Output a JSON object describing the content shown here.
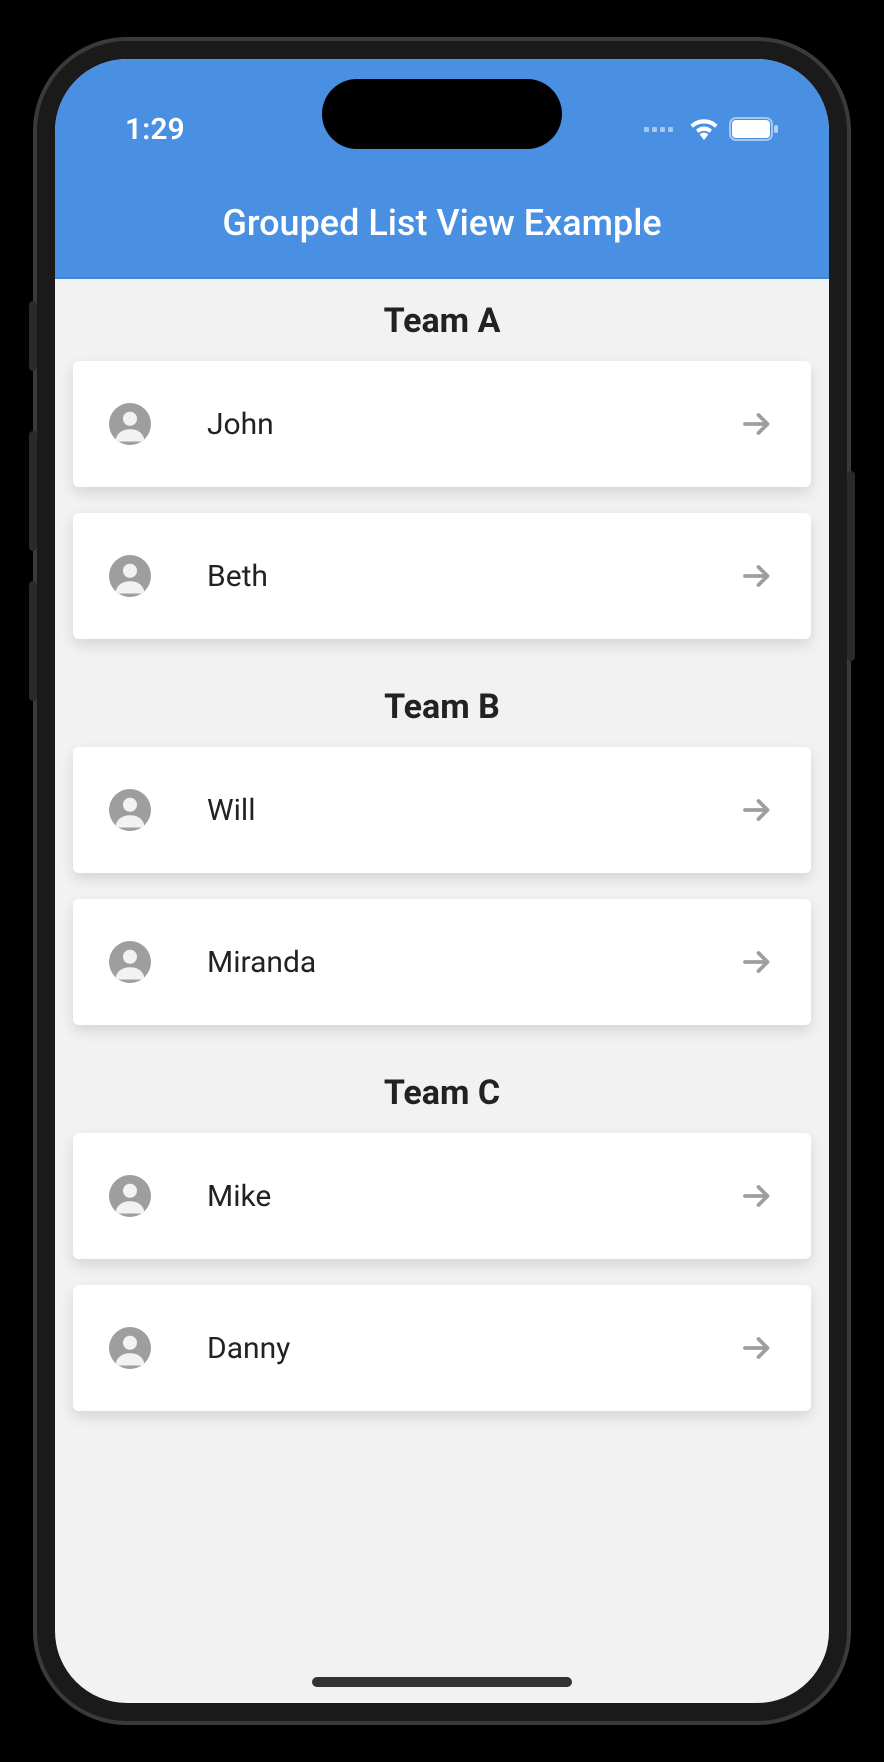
{
  "status": {
    "time": "1:29"
  },
  "header": {
    "title": "Grouped List View Example"
  },
  "groups": [
    {
      "title": "Team A",
      "items": [
        {
          "name": "John"
        },
        {
          "name": "Beth"
        }
      ]
    },
    {
      "title": "Team B",
      "items": [
        {
          "name": "Will"
        },
        {
          "name": "Miranda"
        }
      ]
    },
    {
      "title": "Team C",
      "items": [
        {
          "name": "Mike"
        },
        {
          "name": "Danny"
        }
      ]
    }
  ]
}
